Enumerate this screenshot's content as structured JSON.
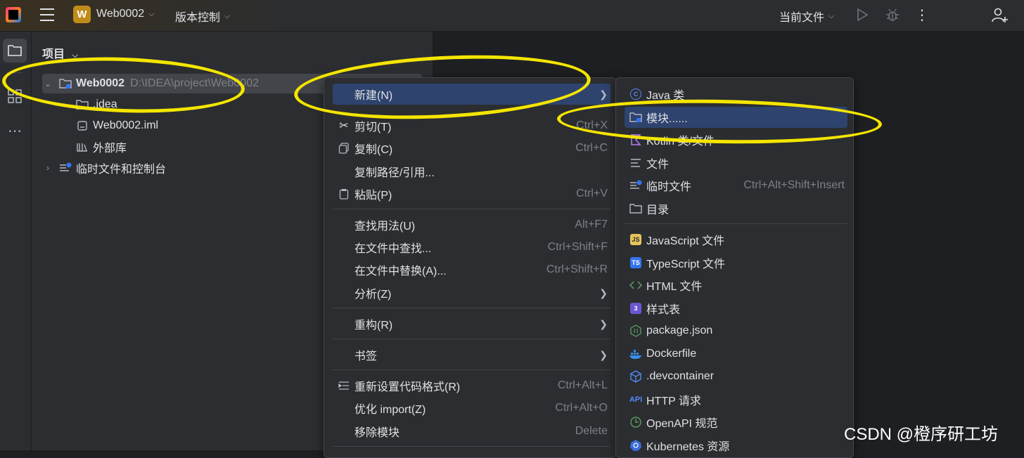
{
  "titlebar": {
    "project_badge": "W",
    "project_name": "Web0002",
    "vcs": "版本控制",
    "current_file": "当前文件"
  },
  "panel": {
    "title": "项目",
    "tree": [
      {
        "label": "Web0002",
        "path": "D:\\IDEA\\project\\Web0002"
      },
      {
        "label": ".idea"
      },
      {
        "label": "Web0002.iml"
      },
      {
        "label": "外部库"
      },
      {
        "label": "临时文件和控制台"
      }
    ]
  },
  "context_menu": {
    "items": [
      {
        "label": "新建(N)",
        "shortcut": ""
      },
      {
        "label": "剪切(T)",
        "shortcut": "Ctrl+X"
      },
      {
        "label": "复制(C)",
        "shortcut": "Ctrl+C"
      },
      {
        "label": "复制路径/引用...",
        "shortcut": ""
      },
      {
        "label": "粘贴(P)",
        "shortcut": "Ctrl+V"
      },
      {
        "label": "查找用法(U)",
        "shortcut": "Alt+F7"
      },
      {
        "label": "在文件中查找...",
        "shortcut": "Ctrl+Shift+F"
      },
      {
        "label": "在文件中替换(A)...",
        "shortcut": "Ctrl+Shift+R"
      },
      {
        "label": "分析(Z)",
        "shortcut": ""
      },
      {
        "label": "重构(R)",
        "shortcut": ""
      },
      {
        "label": "书签",
        "shortcut": ""
      },
      {
        "label": "重新设置代码格式(R)",
        "shortcut": "Ctrl+Alt+L"
      },
      {
        "label": "优化 import(Z)",
        "shortcut": "Ctrl+Alt+O"
      },
      {
        "label": "移除模块",
        "shortcut": "Delete"
      }
    ]
  },
  "new_submenu": {
    "items": [
      {
        "label": "Java 类",
        "shortcut": ""
      },
      {
        "label": "模块......",
        "shortcut": ""
      },
      {
        "label": "Kotlin 类/文件",
        "shortcut": ""
      },
      {
        "label": "文件",
        "shortcut": ""
      },
      {
        "label": "临时文件",
        "shortcut": "Ctrl+Alt+Shift+Insert"
      },
      {
        "label": "目录",
        "shortcut": ""
      },
      {
        "label": "JavaScript 文件",
        "shortcut": ""
      },
      {
        "label": "TypeScript 文件",
        "shortcut": ""
      },
      {
        "label": "HTML 文件",
        "shortcut": ""
      },
      {
        "label": "样式表",
        "shortcut": ""
      },
      {
        "label": "package.json",
        "shortcut": ""
      },
      {
        "label": "Dockerfile",
        "shortcut": ""
      },
      {
        "label": ".devcontainer",
        "shortcut": ""
      },
      {
        "label": "HTTP 请求",
        "shortcut": ""
      },
      {
        "label": "OpenAPI 规范",
        "shortcut": ""
      },
      {
        "label": "Kubernetes 资源",
        "shortcut": ""
      }
    ],
    "icon_badges": {
      "js": "JS",
      "ts": "TS",
      "css": "3",
      "api": "API",
      "java": "C",
      "kotlin": "K"
    }
  },
  "watermark": "CSDN @橙序研工坊",
  "colors": {
    "highlight": "#2e436e",
    "annotation": "#f4e500",
    "project_badge": "#c08b1a"
  }
}
